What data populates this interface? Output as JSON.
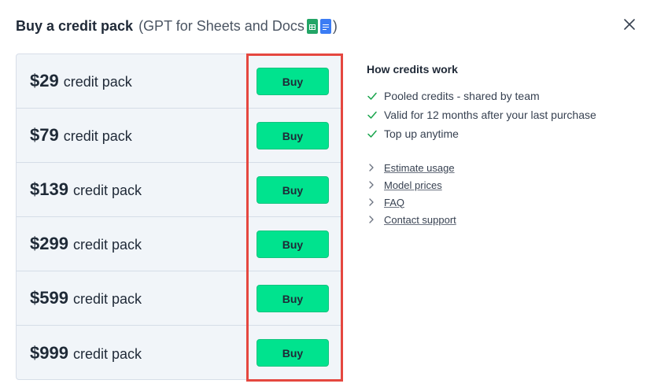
{
  "header": {
    "title": "Buy a credit pack",
    "subtitle_open": "(GPT for Sheets and Docs",
    "subtitle_close": ")",
    "icons": [
      "google-sheets-icon",
      "google-docs-icon"
    ]
  },
  "close": {
    "icon": "close-icon"
  },
  "packs": [
    {
      "price": "$29",
      "label": "credit pack",
      "button": "Buy"
    },
    {
      "price": "$79",
      "label": "credit pack",
      "button": "Buy"
    },
    {
      "price": "$139",
      "label": "credit pack",
      "button": "Buy"
    },
    {
      "price": "$299",
      "label": "credit pack",
      "button": "Buy"
    },
    {
      "price": "$599",
      "label": "credit pack",
      "button": "Buy"
    },
    {
      "price": "$999",
      "label": "credit pack",
      "button": "Buy"
    }
  ],
  "info": {
    "title": "How credits work",
    "features": [
      "Pooled credits - shared by team",
      "Valid for 12 months after your last purchase",
      "Top up anytime"
    ],
    "links": [
      "Estimate usage",
      "Model prices",
      "FAQ",
      "Contact support"
    ]
  },
  "colors": {
    "buy_button": "#00e38e",
    "check": "#16a34a",
    "highlight": "#e5473f",
    "pack_background": "#f1f5f9"
  }
}
